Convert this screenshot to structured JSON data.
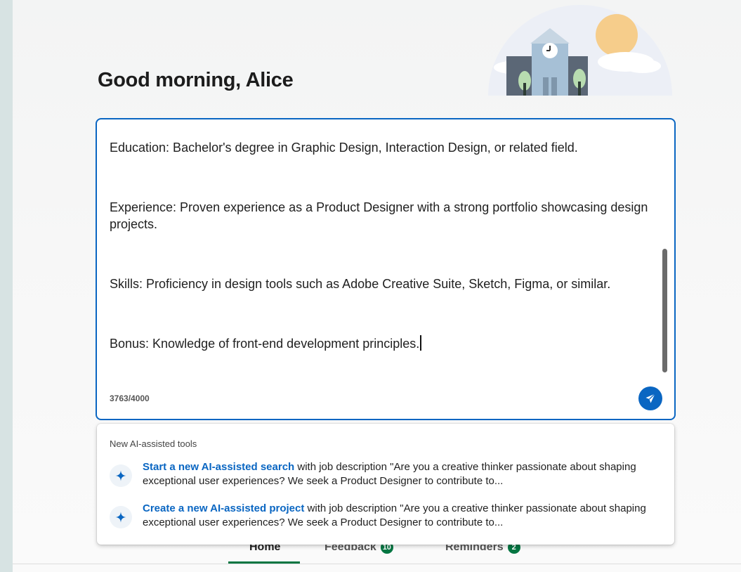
{
  "greeting": "Good morning, Alice",
  "composer": {
    "paragraphs": [
      "Education: Bachelor's degree in Graphic Design, Interaction Design, or related field.",
      "Experience: Proven experience as a Product Designer with a strong portfolio showcasing design projects.",
      "Skills: Proficiency in design tools such as Adobe Creative Suite, Sketch, Figma, or similar.",
      "Bonus: Knowledge of front-end development principles."
    ],
    "char_count": "3763/4000",
    "accent_color": "#0a66c2"
  },
  "tabs": [
    {
      "label": "Home",
      "badge": ""
    },
    {
      "label": "Feedback",
      "badge": "10"
    },
    {
      "label": "Reminders",
      "badge": "2"
    }
  ],
  "dropdown": {
    "heading": "New AI-assisted tools",
    "items": [
      {
        "link": "Start a new AI-assisted search",
        "rest": " with job description \"Are you a creative thinker passionate about shaping exceptional user experiences? We seek a Product Designer to contribute to...",
        "icon": "sparkle-icon"
      },
      {
        "link": "Create a new AI-assisted project",
        "rest": " with job description \"Are you a creative thinker passionate about shaping exceptional user experiences? We seek a Product Designer to contribute to...",
        "icon": "sparkle-icon"
      }
    ]
  },
  "colors": {
    "brand_blue": "#0a66c2",
    "badge_green": "#057642"
  }
}
